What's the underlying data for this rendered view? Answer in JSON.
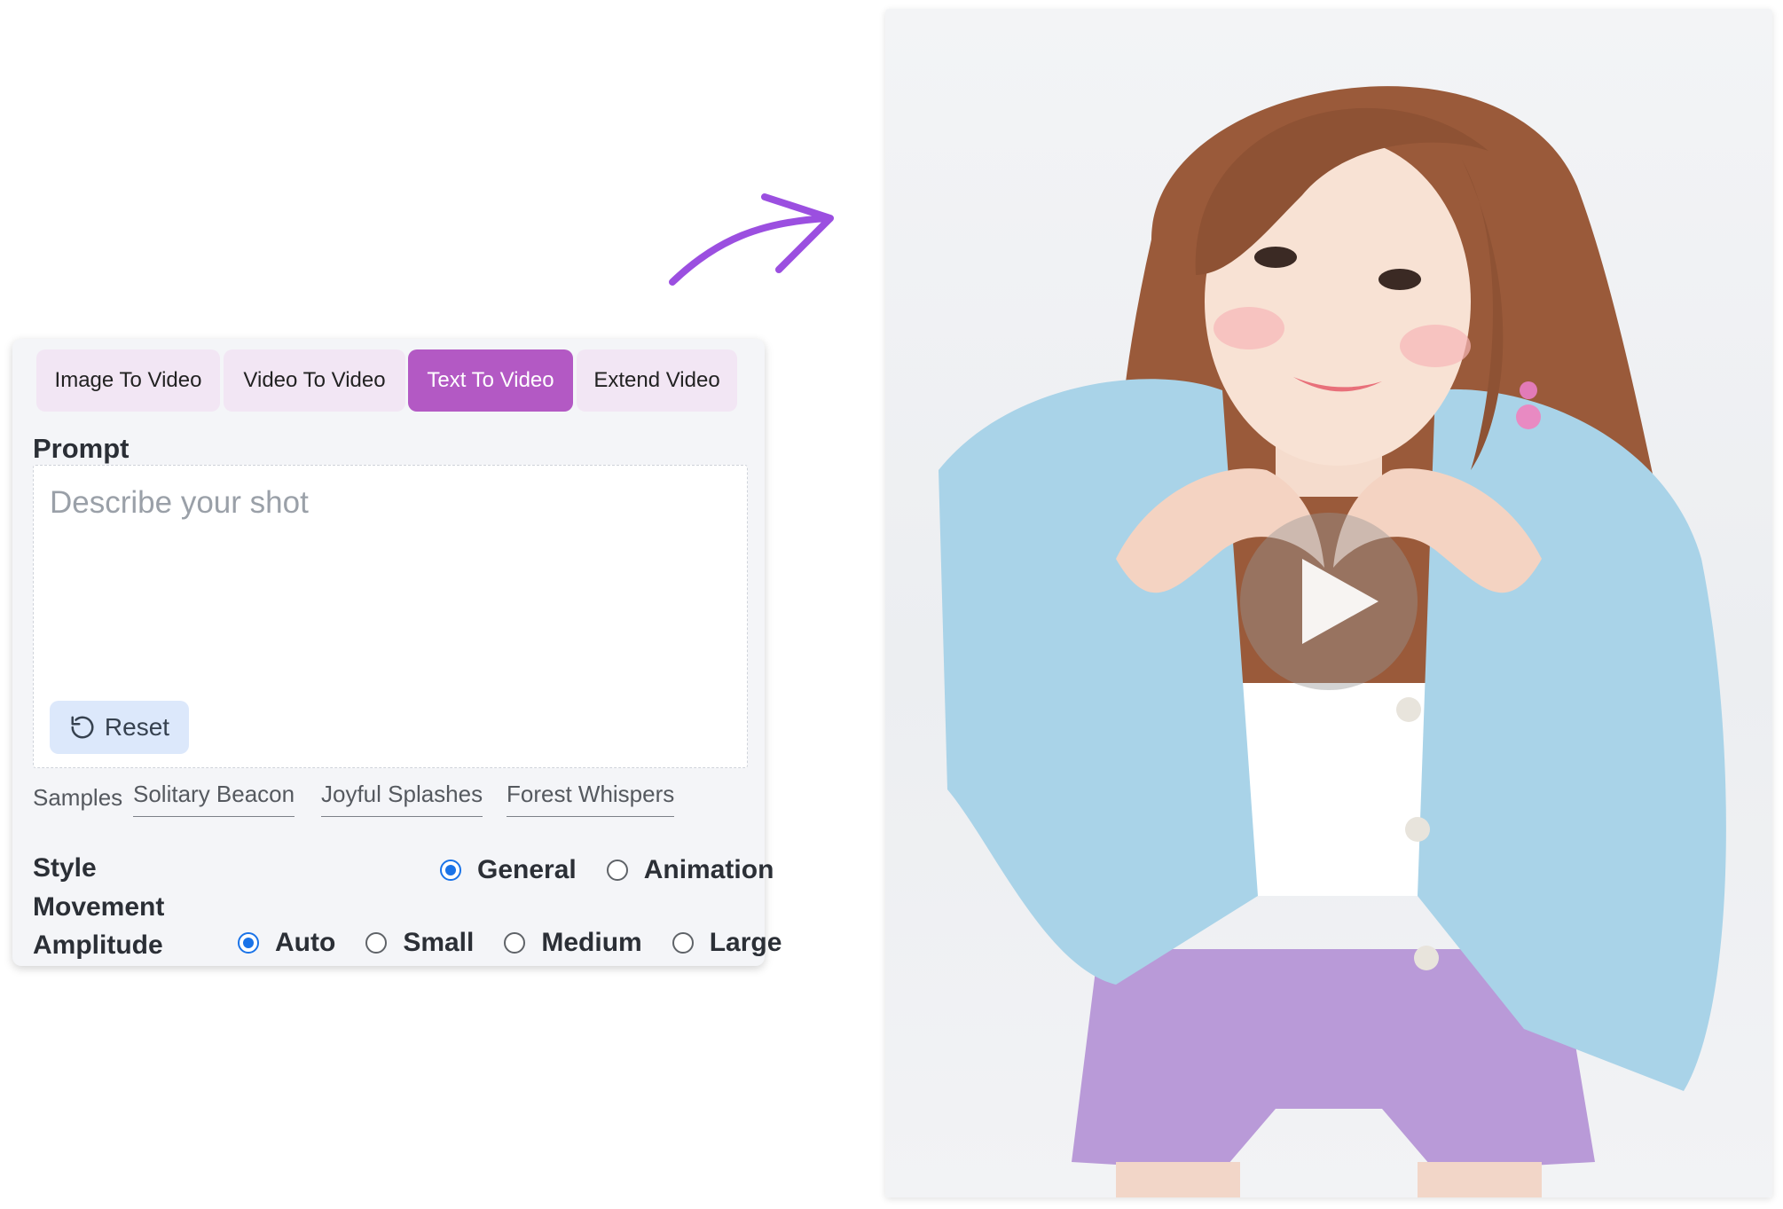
{
  "tabs": [
    {
      "label": "Image To Video",
      "active": false
    },
    {
      "label": "Video To Video",
      "active": false
    },
    {
      "label": "Text To Video",
      "active": true
    },
    {
      "label": "Extend Video",
      "active": false
    }
  ],
  "prompt": {
    "label": "Prompt",
    "placeholder": "Describe your shot",
    "value": "",
    "reset_label": "Reset"
  },
  "samples": {
    "label": "Samples",
    "items": [
      "Solitary Beacon",
      "Joyful Splashes",
      "Forest Whispers"
    ]
  },
  "style": {
    "label": "Style",
    "options": [
      "General",
      "Animation"
    ],
    "selected": "General"
  },
  "movement": {
    "label_line1": "Movement",
    "label_line2": "Amplitude",
    "options": [
      "Auto",
      "Small",
      "Medium",
      "Large"
    ],
    "selected": "Auto"
  },
  "colors": {
    "accent": "#b359c4",
    "tab_bg": "#f2e6f4",
    "reset_bg": "#dce8fb",
    "radio_checked": "#1a73e8",
    "arrow": "#9b4fe0"
  },
  "icons": {
    "arrow": "curved-arrow-icon",
    "reset": "rotate-ccw-icon",
    "play": "play-icon"
  }
}
